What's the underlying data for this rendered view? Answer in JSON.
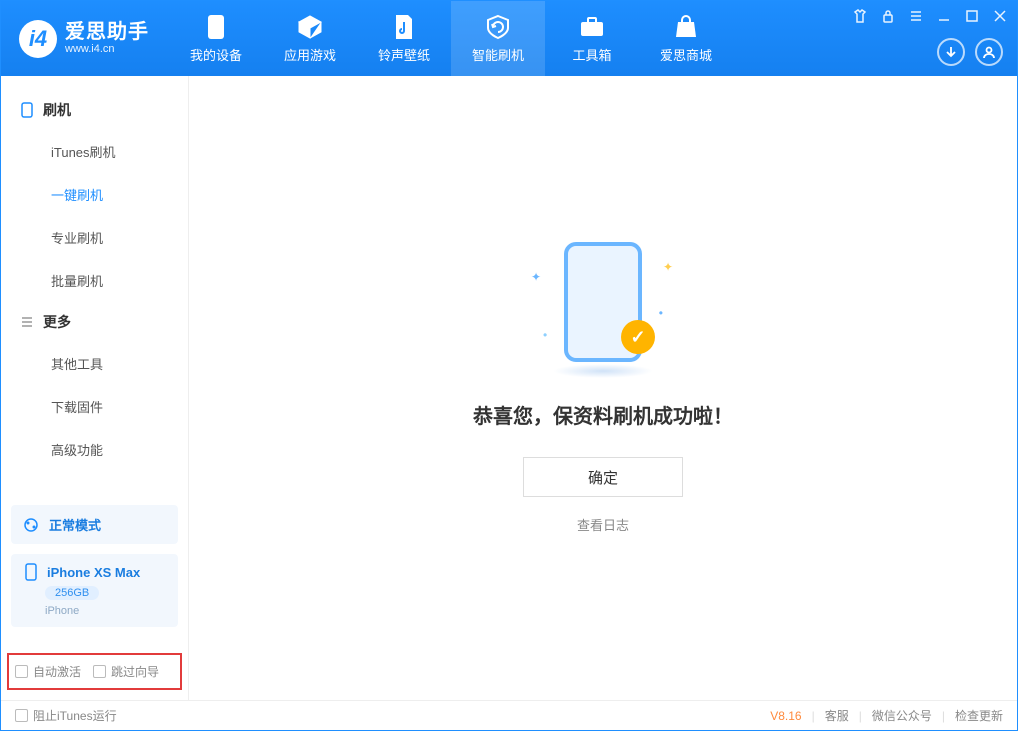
{
  "app": {
    "title": "爱思助手",
    "subtitle": "www.i4.cn"
  },
  "nav": {
    "items": [
      {
        "label": "我的设备"
      },
      {
        "label": "应用游戏"
      },
      {
        "label": "铃声壁纸"
      },
      {
        "label": "智能刷机"
      },
      {
        "label": "工具箱"
      },
      {
        "label": "爱思商城"
      }
    ]
  },
  "sidebar": {
    "group1": {
      "title": "刷机",
      "items": [
        "iTunes刷机",
        "一键刷机",
        "专业刷机",
        "批量刷机"
      ]
    },
    "group2": {
      "title": "更多",
      "items": [
        "其他工具",
        "下载固件",
        "高级功能"
      ]
    },
    "mode": {
      "label": "正常模式"
    },
    "device": {
      "name": "iPhone XS Max",
      "storage": "256GB",
      "type": "iPhone"
    },
    "checks": {
      "auto_activate": "自动激活",
      "skip_guide": "跳过向导"
    }
  },
  "main": {
    "success_title": "恭喜您，保资料刷机成功啦！",
    "confirm": "确定",
    "view_log": "查看日志"
  },
  "footer": {
    "block_itunes": "阻止iTunes运行",
    "version": "V8.16",
    "links": {
      "service": "客服",
      "wechat": "微信公众号",
      "update": "检查更新"
    }
  }
}
